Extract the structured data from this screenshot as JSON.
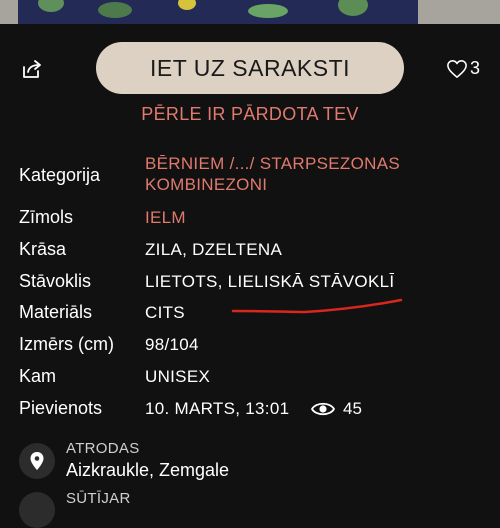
{
  "header": {
    "main_button_label": "IET UZ SARAKSTI",
    "like_count": "3",
    "share_icon": "share-icon",
    "heart_icon": "heart-outline-icon"
  },
  "sold_notice": "PĒRLE IR PĀRDOTA TEV",
  "details": {
    "category_label": "Kategorija",
    "category_line1": "BĒRNIEM /.../ STARPSEZONAS",
    "category_line2": "KOMBINEZONI",
    "brand_label": "Zīmols",
    "brand_value": "IELM",
    "color_label": "Krāsa",
    "color_value": "ZILA, DZELTENA",
    "condition_label": "Stāvoklis",
    "condition_value": "LIETOTS, LIELISKĀ STĀVOKLĪ",
    "material_label": "Materiāls",
    "material_value": "CITS",
    "size_label": "Izmērs (cm)",
    "size_value": "98/104",
    "gender_label": "Kam",
    "gender_value": "UNISEX",
    "added_label": "Pievienots",
    "added_value": "10. MARTS, 13:01",
    "views_value": "45"
  },
  "location": {
    "caption": "ATRODAS",
    "value": "Aizkraukle, Zemgale",
    "icon": "location-pin-icon"
  },
  "seller": {
    "caption": "SŪTĪJAR"
  },
  "colors": {
    "background": "#111111",
    "accent": "#e07a6d",
    "button": "#ddd1c3",
    "annotation_underline": "#d9271c"
  }
}
